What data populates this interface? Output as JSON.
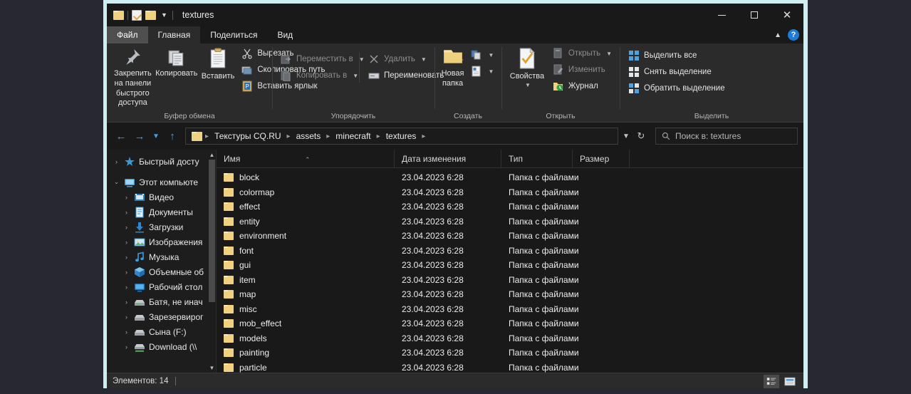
{
  "window": {
    "title": "textures",
    "quick_access": [
      "folder-icon",
      "properties-icon",
      "new-folder-icon",
      "customize-caret-icon"
    ],
    "controls": {
      "minimize": "—",
      "maximize": "□",
      "close": "×"
    }
  },
  "ribbon": {
    "tabs": [
      {
        "label": "Файл",
        "state": "file"
      },
      {
        "label": "Главная",
        "state": "active"
      },
      {
        "label": "Поделиться",
        "state": "normal"
      },
      {
        "label": "Вид",
        "state": "normal"
      }
    ],
    "collapse_icon": "chevron-up-icon",
    "help_label": "?",
    "groups": [
      {
        "title": "Буфер обмена",
        "big": [
          {
            "label": "Закрепить на панели\nбыстрого доступа",
            "icon": "pin-icon"
          },
          {
            "label": "Копировать",
            "icon": "copy-icon"
          },
          {
            "label": "Вставить",
            "icon": "paste-icon"
          }
        ],
        "small": [
          {
            "label": "Вырезать",
            "icon": "scissors-icon",
            "dim": false
          },
          {
            "label": "Скопировать путь",
            "icon": "copy-path-icon",
            "dim": false
          },
          {
            "label": "Вставить ярлык",
            "icon": "paste-shortcut-icon",
            "dim": false
          }
        ]
      },
      {
        "title": "Упорядочить",
        "small": [
          {
            "label": "Переместить в",
            "icon": "move-to-icon",
            "dim": true,
            "caret": true
          },
          {
            "label": "Копировать в",
            "icon": "copy-to-icon",
            "dim": true,
            "caret": true
          }
        ],
        "small2": [
          {
            "label": "Удалить",
            "icon": "delete-icon",
            "dim": true,
            "caret": true
          },
          {
            "label": "Переименовать",
            "icon": "rename-icon",
            "dim": false,
            "caret": false
          }
        ]
      },
      {
        "title": "Создать",
        "big": [
          {
            "label": "Новая\nпапка",
            "icon": "new-folder-icon"
          }
        ],
        "stack": [
          {
            "icon": "new-item-icon",
            "caret": true
          },
          {
            "icon": "easy-access-icon",
            "caret": true
          }
        ]
      },
      {
        "title": "Открыть",
        "big": [
          {
            "label": "Свойства",
            "icon": "properties-icon",
            "caret": true
          }
        ],
        "small": [
          {
            "label": "Открыть",
            "icon": "open-icon",
            "dim": true,
            "caret": true
          },
          {
            "label": "Изменить",
            "icon": "edit-icon",
            "dim": true,
            "caret": false
          },
          {
            "label": "Журнал",
            "icon": "history-icon",
            "dim": false,
            "caret": false
          }
        ]
      },
      {
        "title": "Выделить",
        "small": [
          {
            "label": "Выделить все",
            "icon": "select-all-icon",
            "dim": false
          },
          {
            "label": "Снять выделение",
            "icon": "select-none-icon",
            "dim": false
          },
          {
            "label": "Обратить выделение",
            "icon": "invert-selection-icon",
            "dim": false
          }
        ]
      }
    ]
  },
  "addressbar": {
    "back_icon": "arrow-left-icon",
    "forward_icon": "arrow-right-icon",
    "recent_icon": "chevron-down-icon",
    "up_icon": "arrow-up-icon",
    "breadcrumbs": [
      "Текстуры CQ.RU",
      "assets",
      "minecraft",
      "textures"
    ],
    "history_icon": "chevron-down-icon",
    "refresh_icon": "refresh-icon",
    "search_placeholder": "Поиск в: textures",
    "search_icon": "search-icon"
  },
  "navpane": {
    "items": [
      {
        "label": "Быстрый досту",
        "icon": "star-icon",
        "level": 0,
        "chev": "›"
      },
      {
        "label": "Этот компьюте",
        "icon": "computer-icon",
        "level": 0,
        "chev": "⌄"
      },
      {
        "label": "Видео",
        "icon": "videos-icon",
        "level": 1,
        "chev": "›"
      },
      {
        "label": "Документы",
        "icon": "documents-icon",
        "level": 1,
        "chev": "›"
      },
      {
        "label": "Загрузки",
        "icon": "downloads-icon",
        "level": 1,
        "chev": "›"
      },
      {
        "label": "Изображения",
        "icon": "pictures-icon",
        "level": 1,
        "chev": "›"
      },
      {
        "label": "Музыка",
        "icon": "music-icon",
        "level": 1,
        "chev": "›"
      },
      {
        "label": "Объемные об",
        "icon": "3d-objects-icon",
        "level": 1,
        "chev": "›"
      },
      {
        "label": "Рабочий стол",
        "icon": "desktop-icon",
        "level": 1,
        "chev": "›"
      },
      {
        "label": "Батя, не инач",
        "icon": "drive-icon",
        "level": 1,
        "chev": "›"
      },
      {
        "label": "Зарезервирог",
        "icon": "drive-icon",
        "level": 1,
        "chev": "›"
      },
      {
        "label": "Сына (F:)",
        "icon": "drive-icon",
        "level": 1,
        "chev": "›"
      },
      {
        "label": "Download (\\\\",
        "icon": "network-drive-icon",
        "level": 1,
        "chev": "›"
      }
    ]
  },
  "filelist": {
    "columns": [
      {
        "label": "Имя",
        "key": "name"
      },
      {
        "label": "Дата изменения",
        "key": "date"
      },
      {
        "label": "Тип",
        "key": "type"
      },
      {
        "label": "Размер",
        "key": "size"
      }
    ],
    "sort_indicator": "⌃",
    "rows": [
      {
        "name": "block",
        "date": "23.04.2023 6:28",
        "type": "Папка с файлами",
        "size": ""
      },
      {
        "name": "colormap",
        "date": "23.04.2023 6:28",
        "type": "Папка с файлами",
        "size": ""
      },
      {
        "name": "effect",
        "date": "23.04.2023 6:28",
        "type": "Папка с файлами",
        "size": ""
      },
      {
        "name": "entity",
        "date": "23.04.2023 6:28",
        "type": "Папка с файлами",
        "size": ""
      },
      {
        "name": "environment",
        "date": "23.04.2023 6:28",
        "type": "Папка с файлами",
        "size": ""
      },
      {
        "name": "font",
        "date": "23.04.2023 6:28",
        "type": "Папка с файлами",
        "size": ""
      },
      {
        "name": "gui",
        "date": "23.04.2023 6:28",
        "type": "Папка с файлами",
        "size": ""
      },
      {
        "name": "item",
        "date": "23.04.2023 6:28",
        "type": "Папка с файлами",
        "size": ""
      },
      {
        "name": "map",
        "date": "23.04.2023 6:28",
        "type": "Папка с файлами",
        "size": ""
      },
      {
        "name": "misc",
        "date": "23.04.2023 6:28",
        "type": "Папка с файлами",
        "size": ""
      },
      {
        "name": "mob_effect",
        "date": "23.04.2023 6:28",
        "type": "Папка с файлами",
        "size": ""
      },
      {
        "name": "models",
        "date": "23.04.2023 6:28",
        "type": "Папка с файлами",
        "size": ""
      },
      {
        "name": "painting",
        "date": "23.04.2023 6:28",
        "type": "Папка с файлами",
        "size": ""
      },
      {
        "name": "particle",
        "date": "23.04.2023 6:28",
        "type": "Папка с файлами",
        "size": ""
      }
    ]
  },
  "statusbar": {
    "items_text": "Элементов: 14",
    "details_view_icon": "details-view-icon",
    "large-icons_view_icon": "large-icons-view-icon"
  },
  "colors": {
    "accent_blue": "#1e7bd6",
    "folder_yellow": "#f0d180",
    "window_bg": "#191919",
    "ribbon_bg": "#2b2b2b",
    "desktop_bg": "#272832",
    "frame": "#cfeef2"
  }
}
